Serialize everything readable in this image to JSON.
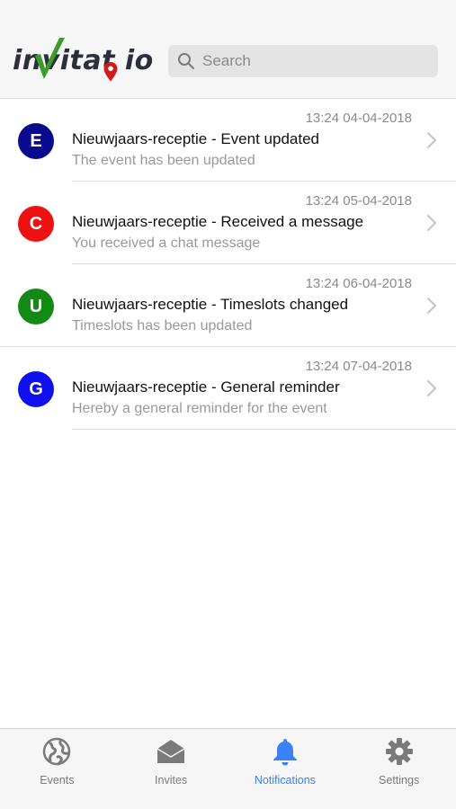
{
  "header": {
    "logo_text": "invitat io",
    "search": {
      "placeholder": "Search",
      "value": ""
    }
  },
  "notifications": [
    {
      "initial": "E",
      "color": "#0a0a8c",
      "time": "13:24 04-04-2018",
      "title": "Nieuwjaars-receptie - Event updated",
      "subtitle": "The event has been updated"
    },
    {
      "initial": "C",
      "color": "#ee1111",
      "time": "13:24 05-04-2018",
      "title": "Nieuwjaars-receptie - Received a message",
      "subtitle": "You received a chat message"
    },
    {
      "initial": "U",
      "color": "#138a13",
      "time": "13:24 06-04-2018",
      "title": "Nieuwjaars-receptie - Timeslots changed",
      "subtitle": "Timeslots has been updated"
    },
    {
      "initial": "G",
      "color": "#1010ee",
      "time": "13:24 07-04-2018",
      "title": "Nieuwjaars-receptie - General reminder",
      "subtitle": "Hereby a general reminder for the event"
    }
  ],
  "tabbar": {
    "active": "notifications",
    "accent": "#3b82f6",
    "tabs": [
      {
        "id": "events",
        "label": "Events",
        "icon": "globe-icon"
      },
      {
        "id": "invites",
        "label": "Invites",
        "icon": "envelope-icon"
      },
      {
        "id": "notifications",
        "label": "Notifications",
        "icon": "bell-icon"
      },
      {
        "id": "settings",
        "label": "Settings",
        "icon": "gear-icon"
      }
    ]
  }
}
